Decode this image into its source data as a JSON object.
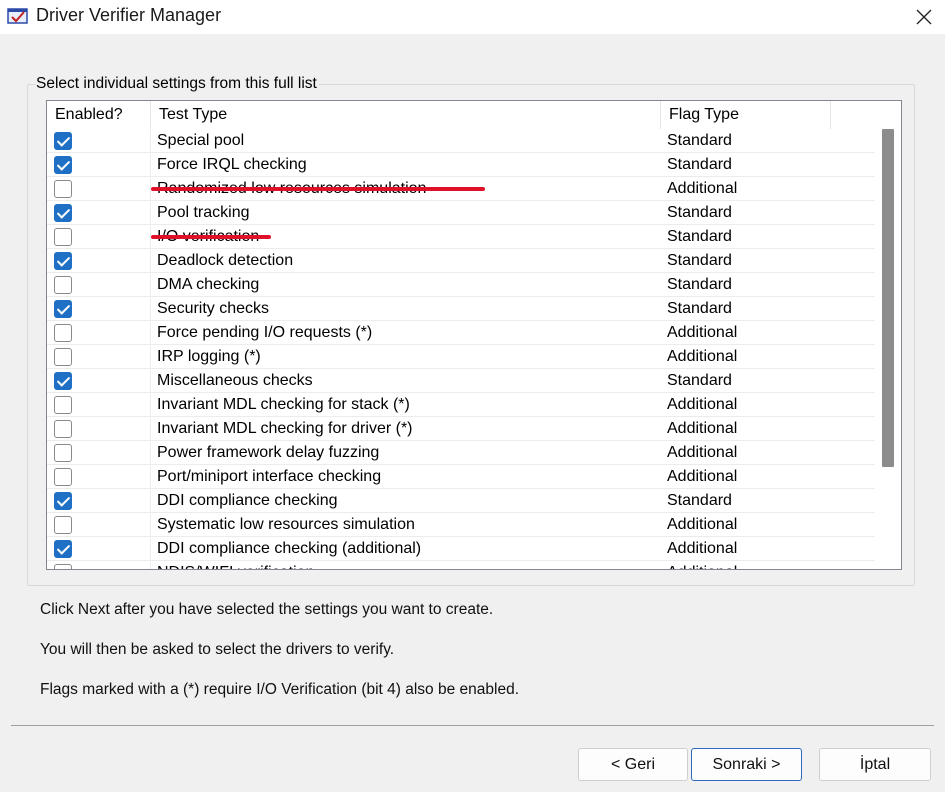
{
  "window": {
    "title": "Driver Verifier Manager"
  },
  "group": {
    "label": "Select individual settings from this full list"
  },
  "columns": [
    "Enabled?",
    "Test Type",
    "Flag Type"
  ],
  "rows": [
    {
      "checked": true,
      "name": "Special pool",
      "flag": "Standard",
      "struck": false
    },
    {
      "checked": true,
      "name": "Force IRQL checking",
      "flag": "Standard",
      "struck": false
    },
    {
      "checked": false,
      "name": "Randomized low resources simulation",
      "flag": "Additional",
      "struck": true
    },
    {
      "checked": true,
      "name": "Pool tracking",
      "flag": "Standard",
      "struck": false
    },
    {
      "checked": false,
      "name": "I/O verification",
      "flag": "Standard",
      "struck": true
    },
    {
      "checked": true,
      "name": "Deadlock detection",
      "flag": "Standard",
      "struck": false
    },
    {
      "checked": false,
      "name": "DMA checking",
      "flag": "Standard",
      "struck": false
    },
    {
      "checked": true,
      "name": "Security checks",
      "flag": "Standard",
      "struck": false
    },
    {
      "checked": false,
      "name": "Force pending I/O requests (*)",
      "flag": "Additional",
      "struck": false
    },
    {
      "checked": false,
      "name": "IRP logging (*)",
      "flag": "Additional",
      "struck": false
    },
    {
      "checked": true,
      "name": "Miscellaneous checks",
      "flag": "Standard",
      "struck": false
    },
    {
      "checked": false,
      "name": "Invariant MDL checking for stack (*)",
      "flag": "Additional",
      "struck": false
    },
    {
      "checked": false,
      "name": "Invariant MDL checking for driver (*)",
      "flag": "Additional",
      "struck": false
    },
    {
      "checked": false,
      "name": "Power framework delay fuzzing",
      "flag": "Additional",
      "struck": false
    },
    {
      "checked": false,
      "name": "Port/miniport interface checking",
      "flag": "Additional",
      "struck": false
    },
    {
      "checked": true,
      "name": "DDI compliance checking",
      "flag": "Standard",
      "struck": false
    },
    {
      "checked": false,
      "name": "Systematic low resources simulation",
      "flag": "Additional",
      "struck": false
    },
    {
      "checked": true,
      "name": "DDI compliance checking (additional)",
      "flag": "Additional",
      "struck": false
    },
    {
      "checked": false,
      "name": "NDIS/WIFI verification",
      "flag": "Additional",
      "struck": false
    }
  ],
  "info": {
    "line1": "Click Next after you have selected the settings you want to create.",
    "line2": "You will then be asked to select the drivers to verify.",
    "line3": "Flags marked with a (*) require I/O Verification (bit 4) also be enabled."
  },
  "buttons": {
    "back": "< Geri",
    "next": "Sonraki >",
    "cancel": "İptal"
  },
  "colors": {
    "accent": "#1f6fc5",
    "strike": "#e0102a"
  }
}
